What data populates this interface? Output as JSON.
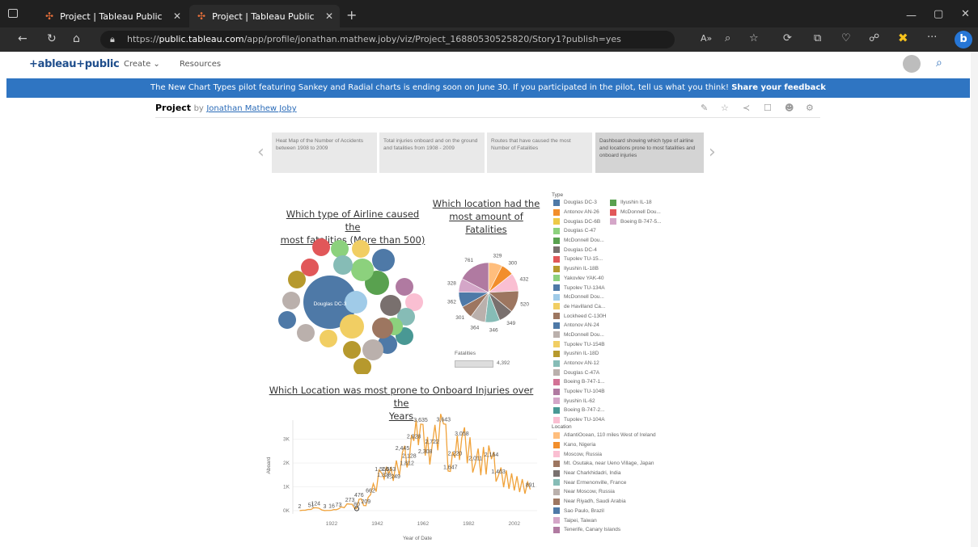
{
  "browser": {
    "tabs": [
      {
        "title": "Project | Tableau Public"
      },
      {
        "title": "Project | Tableau Public"
      }
    ],
    "url_prefix": "https://",
    "url_host": "public.tableau.com",
    "url_path": "/app/profile/jonathan.mathew.joby/viz/Project_16880530525820/Story1?publish=yes"
  },
  "nav": {
    "logo": "+ableau+public",
    "create": "Create",
    "resources": "Resources"
  },
  "banner": {
    "text": "The New Chart Types pilot featuring Sankey and Radial charts is ending soon on June 30. If you participated in the pilot, tell us what you think!",
    "link": "Share your feedback"
  },
  "project": {
    "title": "Project",
    "by": "by",
    "author": "Jonathan Mathew Joby"
  },
  "story_points": [
    {
      "text": "Heat Map of the Number of Accidents between 1908 to 2009"
    },
    {
      "text": "Total injuries onboard and on the ground and fatalities from 1908 - 2009"
    },
    {
      "text": "Routes that have caused the most Number of Fatalities"
    },
    {
      "text": "Dashboard showing which type of airline and locations prone to most fatalities and onboard injuries"
    }
  ],
  "dashboard": {
    "airline_title_1": "Which type of Airline caused the",
    "airline_title_2": "most fatalities (More than 500)",
    "location_title_1": "Which location had the",
    "location_title_2": "most amount of Fatalities",
    "injury_title_1": "Which Location was most prone to Onboard Injuries over the",
    "injury_title_2": "Years",
    "bubble_label": "Douglas DC-3",
    "fatalities_label": "Fatalities",
    "fatalities_value": "4,392",
    "type_legend_title": "Type",
    "location_legend_title": "Location"
  },
  "chart_data": [
    {
      "type": "bubble",
      "title": "Which type of Airline caused the most fatalities (More than 500)",
      "labels": [
        "Douglas DC-3"
      ]
    },
    {
      "type": "pie",
      "title": "Which location had the most amount of Fatalities",
      "values": [
        329,
        300,
        432,
        520,
        349,
        346,
        364,
        301,
        362,
        328,
        761
      ]
    },
    {
      "type": "line",
      "title": "Which Location was most prone to Onboard Injuries over the Years",
      "xlabel": "Year of Date",
      "ylabel": "Aboard",
      "x_ticks": [
        "1922",
        "1942",
        "1962",
        "1982",
        "2002"
      ],
      "y_ticks": [
        "0K",
        "1K",
        "2K",
        "3K"
      ],
      "points": [
        [
          1908,
          2
        ],
        [
          1913,
          51
        ],
        [
          1915,
          124
        ],
        [
          1919,
          3
        ],
        [
          1922,
          16
        ],
        [
          1925,
          73
        ],
        [
          1930,
          273
        ],
        [
          1933,
          80
        ],
        [
          1934,
          476
        ],
        [
          1937,
          209
        ],
        [
          1939,
          662
        ],
        [
          1944,
          1560
        ],
        [
          1945,
          1328
        ],
        [
          1947,
          1553
        ],
        [
          1949,
          1249
        ],
        [
          1953,
          2445
        ],
        [
          1955,
          1812
        ],
        [
          1956,
          2128
        ],
        [
          1958,
          2928
        ],
        [
          1961,
          3635
        ],
        [
          1963,
          2308
        ],
        [
          1966,
          2722
        ],
        [
          1971,
          3643
        ],
        [
          1974,
          1647
        ],
        [
          1976,
          2220
        ],
        [
          1979,
          3058
        ],
        [
          1985,
          2011
        ],
        [
          1992,
          2164
        ],
        [
          1995,
          1463
        ],
        [
          2009,
          891
        ]
      ],
      "labels": [
        "2",
        "51",
        "124",
        "3",
        "16",
        "73",
        "273",
        "80",
        "476",
        "209",
        "662",
        "1,560",
        "1,328",
        "1,553",
        "1,249",
        "2,445",
        "1,812",
        "2,128",
        "2,928",
        "3,635",
        "2,308",
        "2,722",
        "3,643",
        "1,647",
        "2,220",
        "3,058",
        "2,011",
        "2,164",
        "1,463",
        "891"
      ]
    }
  ],
  "type_legend": [
    {
      "name": "Douglas DC-3",
      "color": "#4e79a7"
    },
    {
      "name": "Antonov AN-26",
      "color": "#f28e2b"
    },
    {
      "name": "Douglas DC-6B",
      "color": "#edc948"
    },
    {
      "name": "Douglas C-47",
      "color": "#8cd17d"
    },
    {
      "name": "McDonnell Dou...",
      "color": "#59a14f"
    },
    {
      "name": "Douglas DC-4",
      "color": "#79706e"
    },
    {
      "name": "Tupolev TU-15...",
      "color": "#e15759"
    },
    {
      "name": "Ilyushin IL-18B",
      "color": "#b6992d"
    },
    {
      "name": "Yakovlev YAK-40",
      "color": "#8cd17d"
    },
    {
      "name": "Tupolev TU-134A",
      "color": "#4e79a7"
    },
    {
      "name": "McDonnell Dou...",
      "color": "#a0cbe8"
    },
    {
      "name": "de Havilland Ca...",
      "color": "#f1ce63"
    },
    {
      "name": "Lockheed C-130H",
      "color": "#9d7660"
    },
    {
      "name": "Antonov AN-24",
      "color": "#4e79a7"
    },
    {
      "name": "McDonnell Dou...",
      "color": "#bab0ac"
    },
    {
      "name": "Tupolev TU-154B",
      "color": "#f1ce63"
    },
    {
      "name": "Ilyushin IL-18D",
      "color": "#b6992d"
    },
    {
      "name": "Antonov AN-12",
      "color": "#86bcb6"
    },
    {
      "name": "Douglas C-47A",
      "color": "#bab0ac"
    },
    {
      "name": "Boeing B-747-1...",
      "color": "#d37295"
    },
    {
      "name": "Tupolev TU-104B",
      "color": "#b07aa1"
    },
    {
      "name": "Ilyushin IL-62",
      "color": "#d4a6c8"
    },
    {
      "name": "Boeing B-747-2...",
      "color": "#499894"
    },
    {
      "name": "Tupolev TU-104A",
      "color": "#fabfd2"
    },
    {
      "name": "Ilyushin IL-18",
      "color": "#59a14f"
    },
    {
      "name": "McDonnell Dou...",
      "color": "#e15759"
    },
    {
      "name": "Boeing B-747-5...",
      "color": "#d4a6c8"
    }
  ],
  "location_legend": [
    {
      "name": "AtlantiOcean, 110 miles West of Ireland",
      "color": "#ffbe7d"
    },
    {
      "name": "Kano, Nigeria",
      "color": "#f28e2b"
    },
    {
      "name": "Moscow, Russia",
      "color": "#fabfd2"
    },
    {
      "name": "Mt. Osutaka, near Ueno Village, Japan",
      "color": "#9d7660"
    },
    {
      "name": "Near Charkhidadri, India",
      "color": "#79706e"
    },
    {
      "name": "Near Ermenonville, France",
      "color": "#86bcb6"
    },
    {
      "name": "Near Moscow, Russia",
      "color": "#bab0ac"
    },
    {
      "name": "Near Riyadh, Saudi Arabia",
      "color": "#9d7660"
    },
    {
      "name": "Sao Paulo, Brazil",
      "color": "#4e79a7"
    },
    {
      "name": "Taipei, Taiwan",
      "color": "#d4a6c8"
    },
    {
      "name": "Tenerife, Canary Islands",
      "color": "#b07aa1"
    }
  ]
}
